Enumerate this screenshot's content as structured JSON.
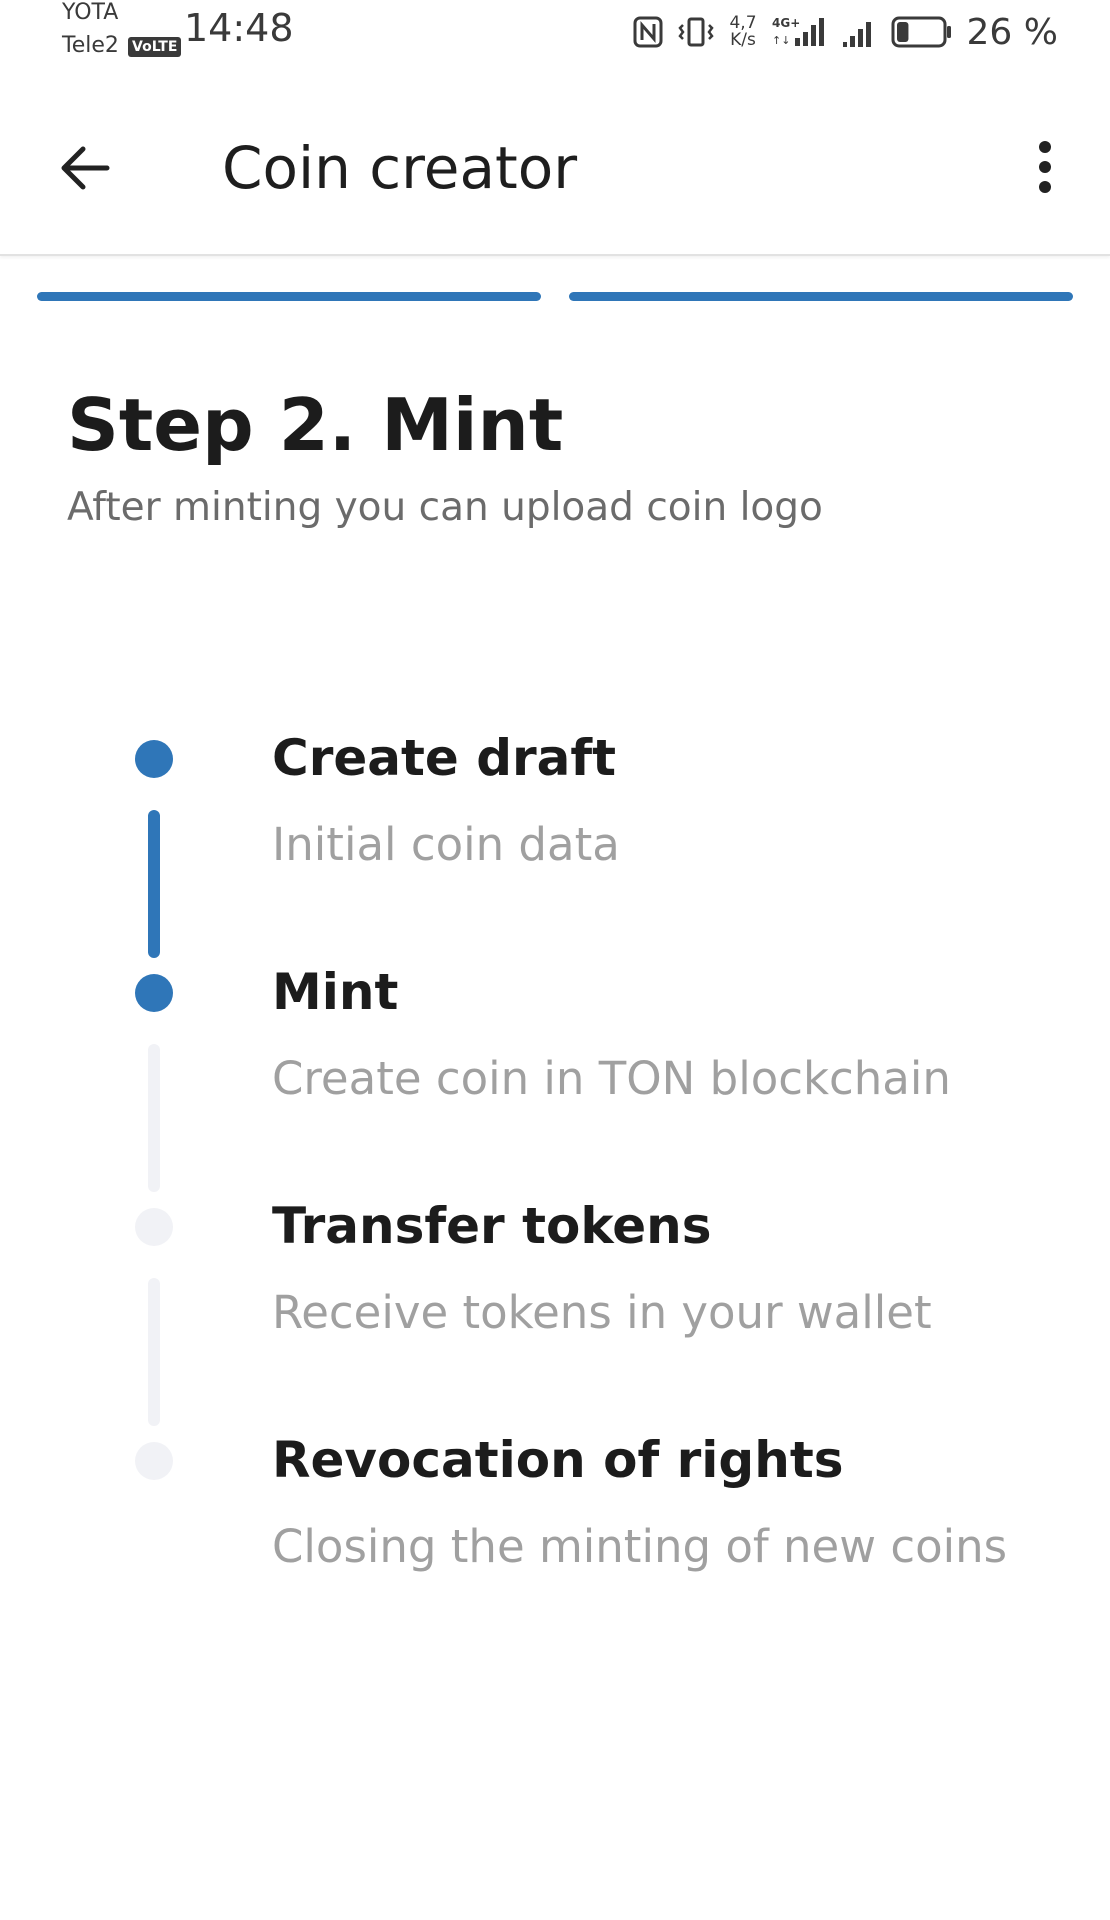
{
  "status_bar": {
    "carrier_top": "YOTA",
    "carrier_bottom": "Tele2",
    "volte_badge": "VoLTE",
    "time": "14:48",
    "net_speed_value": "4,7",
    "net_speed_unit": "K/s",
    "network_type": "4G+",
    "battery_percent": "26 %",
    "battery_level": 0.26
  },
  "app_bar": {
    "title": "Coin creator",
    "back_icon": "arrow-left-icon",
    "menu_icon": "more-vertical-icon"
  },
  "progress": {
    "total_steps": 2,
    "completed_steps": 2,
    "active_color": "#2f76b8"
  },
  "header": {
    "title": "Step 2. Mint",
    "subtitle": "After minting you can upload coin logo"
  },
  "steps": [
    {
      "label": "Create draft",
      "description": "Initial coin data",
      "state": "done"
    },
    {
      "label": "Mint",
      "description": "Create coin in TON blockchain",
      "state": "active"
    },
    {
      "label": "Transfer tokens",
      "description": "Receive tokens in your wallet",
      "state": "pending"
    },
    {
      "label": "Revocation of rights",
      "description": "Closing the minting of new coins",
      "state": "pending"
    }
  ],
  "colors": {
    "accent": "#2f76b8",
    "inactive": "#f1f2f6",
    "description": "#a0a0a0"
  }
}
